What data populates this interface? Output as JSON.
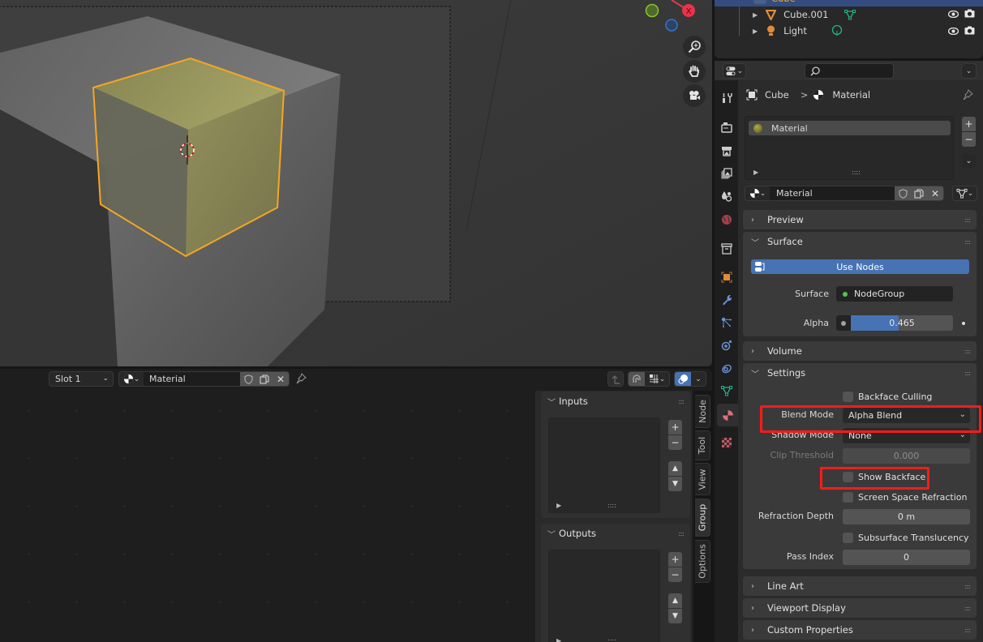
{
  "viewport": {
    "gizmo": {
      "x_label": "X"
    },
    "nav_buttons": [
      "zoom-icon",
      "hand-pan-icon",
      "camera-view-icon"
    ]
  },
  "node_editor": {
    "header": {
      "slot": "Slot 1",
      "material_name": "Material"
    },
    "npanel": {
      "inputs_title": "Inputs",
      "outputs_title": "Outputs"
    },
    "side_tabs": [
      "Node",
      "Tool",
      "View",
      "Group",
      "Options"
    ],
    "active_tab": "Group"
  },
  "outliner": {
    "items": [
      {
        "name": "Cube",
        "selected": true
      },
      {
        "name": "Cube.001",
        "selected": false
      },
      {
        "name": "Light",
        "selected": false
      }
    ]
  },
  "properties": {
    "search_placeholder": "",
    "breadcrumb": {
      "object": "Cube",
      "separator": ">",
      "data": "Material"
    },
    "material_slots": [
      {
        "name": "Material"
      }
    ],
    "material_selector": {
      "name": "Material"
    },
    "panels": {
      "preview": "Preview",
      "surface": "Surface",
      "volume": "Volume",
      "settings": "Settings",
      "line_art": "Line Art",
      "viewport_display": "Viewport Display",
      "custom_properties": "Custom Properties"
    },
    "surface": {
      "use_nodes_label": "Use Nodes",
      "surface_label": "Surface",
      "surface_value": "NodeGroup",
      "alpha_label": "Alpha",
      "alpha_value": "0.465",
      "alpha_fraction": 0.465
    },
    "settings": {
      "backface_culling": {
        "label": "Backface Culling",
        "checked": false
      },
      "blend_mode": {
        "label": "Blend Mode",
        "value": "Alpha Blend"
      },
      "shadow_mode": {
        "label": "Shadow Mode",
        "value": "None"
      },
      "clip_threshold": {
        "label": "Clip Threshold",
        "value": "0.000"
      },
      "show_backface": {
        "label": "Show Backface",
        "checked": false
      },
      "ssr": {
        "label": "Screen Space Refraction",
        "checked": false
      },
      "refraction_depth": {
        "label": "Refraction Depth",
        "value": "0 m"
      },
      "subsurface_translucency": {
        "label": "Subsurface Translucency",
        "checked": false
      },
      "pass_index": {
        "label": "Pass Index",
        "value": "0"
      }
    }
  },
  "colors": {
    "selection_outline": "#f5a623",
    "highlight_box": "#ff1a1a",
    "use_nodes_blue": "#4772b3",
    "outliner_selected": "#334d80"
  }
}
